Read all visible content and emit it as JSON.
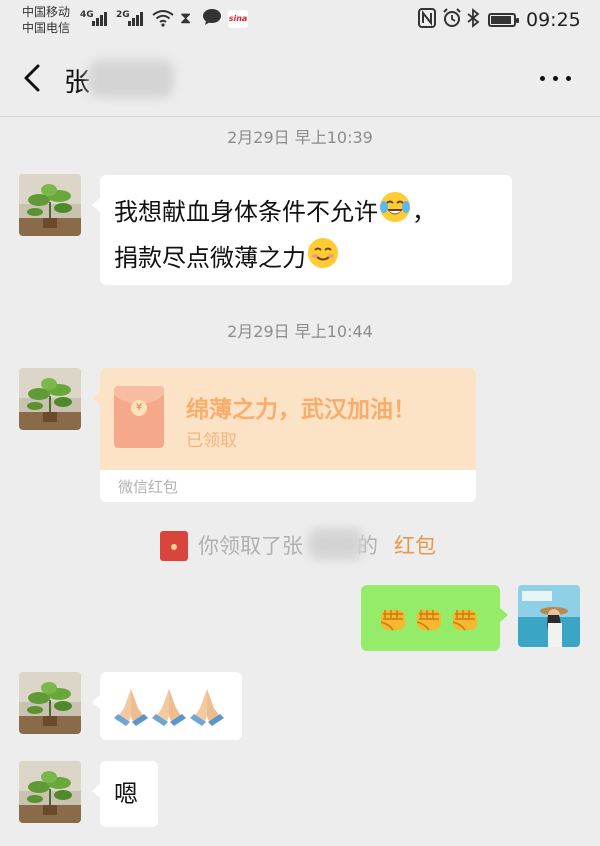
{
  "status_bar": {
    "carrier_1": "中国移动",
    "carrier_2": "中国电信",
    "network_1": "4G",
    "network_2": "2G",
    "time": "09:25",
    "icons": [
      "signal-icon",
      "wifi-icon",
      "hourglass-icon",
      "chat-bubble-icon",
      "sina-weibo-icon",
      "nfc-icon",
      "alarm-icon",
      "bluetooth-icon",
      "battery-icon"
    ],
    "battery_level": 0.9,
    "sina_label": "sina"
  },
  "header": {
    "title": "张",
    "more_label": "more-icon"
  },
  "messages": [
    {
      "timestamp": "2月29日 早上10:39",
      "sender": "contact",
      "text_line_1": "我想献血身体条件不允许",
      "text_line_1_end": "，",
      "text_line_2": "捐款尽点微薄之力"
    },
    {
      "timestamp": "2月29日 早上10:44",
      "sender": "contact",
      "red_packet": {
        "title": "绵薄之力，武汉加油！",
        "status": "已领取",
        "footer": "微信红包"
      }
    },
    {
      "system_notice": {
        "prefix": "你领取了张",
        "middle": "的",
        "link": "红包"
      }
    },
    {
      "sender": "me",
      "emoji": [
        "fist-emoji",
        "fist-emoji",
        "fist-emoji"
      ]
    },
    {
      "sender": "contact",
      "emoji": [
        "folded-hands-emoji",
        "folded-hands-emoji",
        "folded-hands-emoji"
      ]
    },
    {
      "sender": "contact",
      "text": "嗯"
    }
  ],
  "colors": {
    "background": "#ededed",
    "my_bubble": "#95ec69",
    "their_bubble": "#ffffff",
    "red_packet_bg": "#fde3c6",
    "red_packet_text": "#f9ad6c",
    "link": "#e9984a"
  }
}
